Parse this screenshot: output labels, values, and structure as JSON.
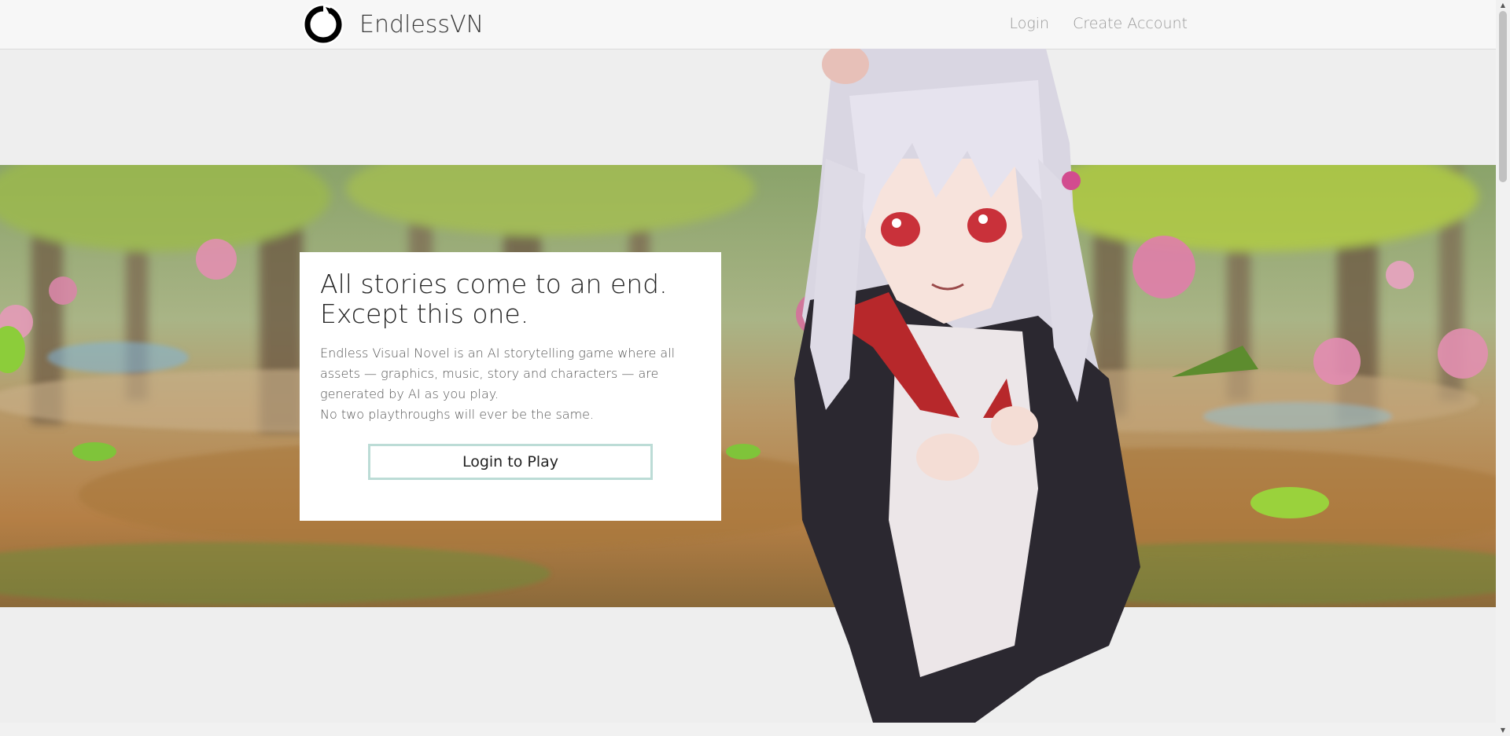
{
  "navbar": {
    "brand": {
      "name": "EndlessVN",
      "logo_icon": "ouroboros-icon"
    },
    "links": [
      {
        "label": "Login"
      },
      {
        "label": "Create Account"
      }
    ]
  },
  "hero": {
    "headline_line1": "All stories come to an end.",
    "headline_line2": "Except this one.",
    "description_lines": [
      "Endless Visual Novel is an AI storytelling game where all",
      "assets — graphics, music, story and characters — are",
      "generated by AI as you play.",
      "No two playthroughs will ever be the same."
    ],
    "cta_label": "Login to Play"
  },
  "colors": {
    "background": "#eeeeee",
    "navbar": "#f7f7f7",
    "button_border": "#bcdcd6"
  }
}
